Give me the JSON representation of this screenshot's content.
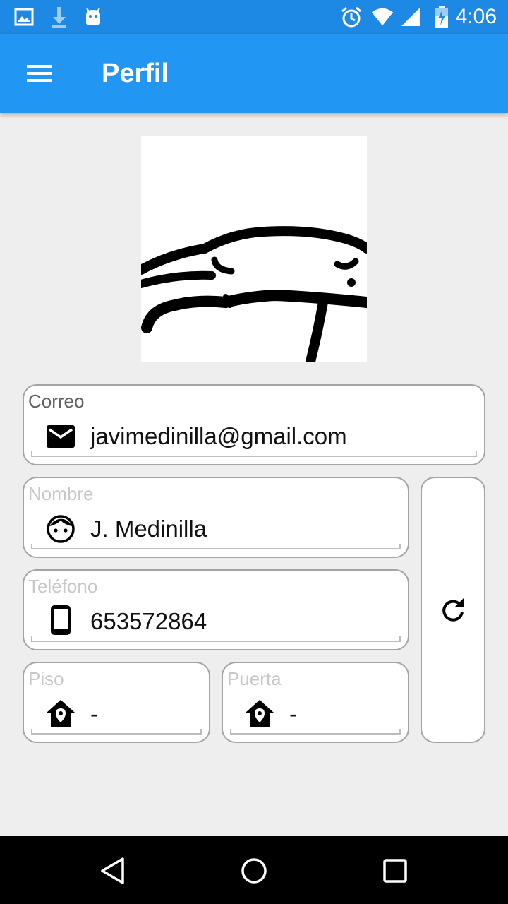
{
  "status_bar": {
    "time": "4:06",
    "left_icons": [
      "image-icon",
      "download-icon",
      "android-icon"
    ],
    "right_icons": [
      "alarm-icon",
      "wifi-icon",
      "signal-icon",
      "battery-icon"
    ]
  },
  "app_bar": {
    "title": "Perfil",
    "menu_icon": "hamburger-menu-icon",
    "color": "#2196f3"
  },
  "profile": {
    "email_label": "Correo",
    "email_value": "javimedinilla@gmail.com",
    "email_icon": "mail-icon",
    "name_label": "Nombre",
    "name_value": "J. Medinilla",
    "name_icon": "face-icon",
    "phone_label": "Teléfono",
    "phone_value": "653572864",
    "phone_icon": "phone-icon",
    "floor_label": "Piso",
    "floor_value": "-",
    "floor_icon": "home-pin-icon",
    "door_label": "Puerta",
    "door_value": "-",
    "door_icon": "home-pin-icon",
    "refresh_icon": "refresh-icon"
  },
  "nav_bar": {
    "icons": [
      "back-icon",
      "home-icon",
      "recents-icon"
    ]
  }
}
